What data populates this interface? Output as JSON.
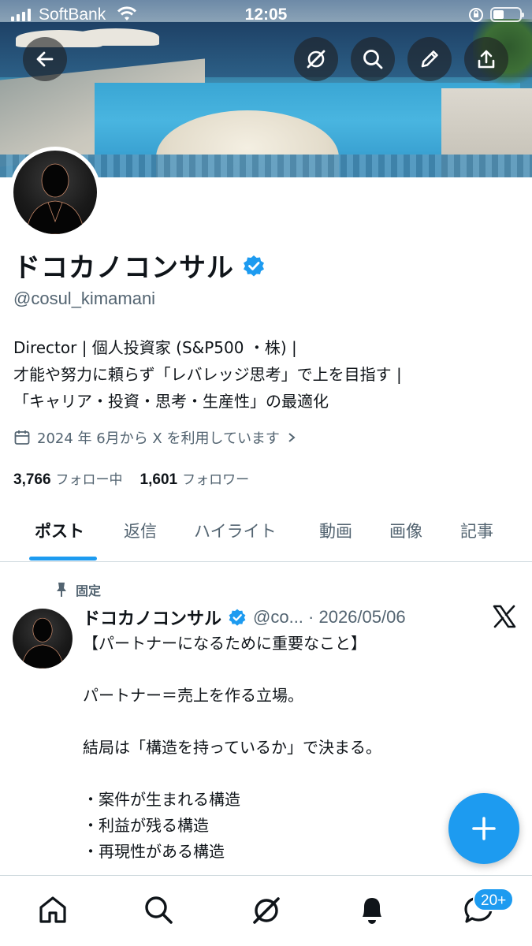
{
  "status_bar": {
    "carrier": "SoftBank",
    "time": "12:05"
  },
  "profile": {
    "display_name": "ドコカノコンサル",
    "handle": "@cosul_kimamani",
    "bio_lines": [
      "Director | 個人投資家 (S&P500 ・株) |",
      "才能や努力に頼らず「レバレッジ思考」で上を目指す |",
      "「キャリア・投資・思考・生産性」の最適化"
    ],
    "joined": "2024 年 6月から X を利用しています",
    "following_count": "3,766",
    "following_label": "フォロー中",
    "followers_count": "1,601",
    "followers_label": "フォロワー"
  },
  "tabs": [
    "ポスト",
    "返信",
    "ハイライト",
    "動画",
    "画像",
    "記事"
  ],
  "active_tab": "ポスト",
  "pinned_post": {
    "pinned_label": "固定",
    "author": "ドコカノコンサル",
    "meta": "@co... · 2026/05/06",
    "body": "【パートナーになるために重要なこと】\n\nパートナー＝売上を作る立場。\n\n結局は「構造を持っているか」で決まる。\n\n・案件が生まれる構造\n・利益が残る構造\n・再現性がある構造"
  },
  "notifications_badge": "20+",
  "colors": {
    "accent": "#1d9bf0",
    "text": "#0f1419",
    "muted": "#536471"
  },
  "icons": [
    "back-arrow-icon",
    "grok-icon",
    "search-icon",
    "edit-icon",
    "share-icon",
    "verified-icon",
    "calendar-icon",
    "chevron-right-icon",
    "pin-icon",
    "x-logo-icon",
    "plus-icon",
    "home-icon",
    "bell-icon",
    "messages-icon"
  ]
}
